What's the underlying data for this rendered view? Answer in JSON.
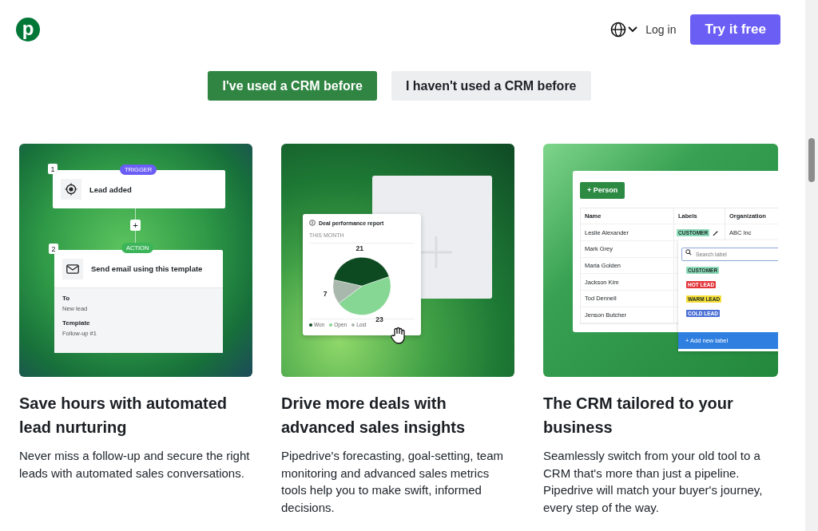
{
  "header": {
    "logo": "p",
    "login": "Log in",
    "cta": "Try it free"
  },
  "toggle": [
    {
      "label": "I've used a CRM before",
      "selected": true
    },
    {
      "label": "I haven't used a CRM before",
      "selected": false
    }
  ],
  "cards": [
    {
      "kind": "workflow",
      "title": "Save hours with automated lead nurturing",
      "body": "Never miss a follow-up and secure the right leads with automated sales conversations.",
      "workflow": {
        "trigger_step": "1",
        "trigger_tag": "TRIGGER",
        "trigger_text": "Lead added",
        "add": "+",
        "action_step": "2",
        "action_tag": "ACTION",
        "action_text": "Send email using this template",
        "fields": [
          {
            "label": "To",
            "value": "New lead"
          },
          {
            "label": "Template",
            "value": "Follow-up #1"
          }
        ]
      }
    },
    {
      "kind": "report",
      "title": "Drive more deals with advanced sales insights",
      "body": "Pipedrive's forecasting, goal-setting, team monitoring and advanced sales metrics tools help you to make swift, informed decisions.",
      "report": {
        "title": "Deal performance report",
        "subtitle": "THIS MONTH",
        "chart_data": {
          "type": "pie",
          "categories": [
            "Won",
            "Open",
            "Lost"
          ],
          "values": [
            21,
            23,
            7
          ],
          "data_labels": true
        }
      }
    },
    {
      "kind": "table",
      "title": "The CRM tailored to your business",
      "body": "Seamlessly switch from your old tool to a CRM that's more than just a pipeline. Pipedrive will match your buyer's journey, every step of the way.",
      "table": {
        "add_button": "+ Person",
        "columns": [
          "Name",
          "Labels",
          "Organization"
        ],
        "rows": [
          {
            "name": "Leslie Alexander",
            "label": "CUSTOMER",
            "organization": "ABC Inc"
          },
          {
            "name": "Mark Grey"
          },
          {
            "name": "Maria Golden"
          },
          {
            "name": "Jackson Kim"
          },
          {
            "name": "Tod Dennell"
          },
          {
            "name": "Jenson Butcher"
          }
        ],
        "search_placeholder": "Search label",
        "labels": [
          {
            "text": "CUSTOMER",
            "color": "#8fdcbc"
          },
          {
            "text": "HOT LEAD",
            "color": "#e3363b"
          },
          {
            "text": "WARM LEAD",
            "color": "#f6de3a"
          },
          {
            "text": "COLD LEAD",
            "color": "#4a6fd6"
          }
        ],
        "add_label": "+ Add new label"
      }
    }
  ]
}
